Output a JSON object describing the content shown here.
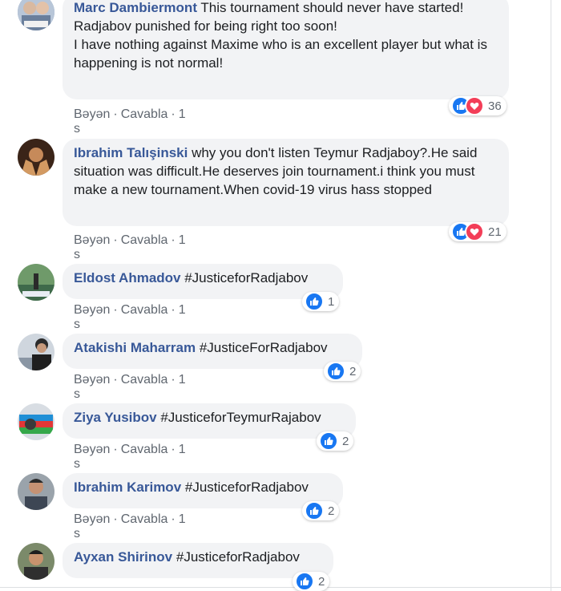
{
  "comments": [
    {
      "author": "Marc Dambiermont",
      "text": " This tournament should never have started!",
      "extra": [
        "Radjabov punished for being right too soon!",
        "I have nothing against Maxime who is an excellent player but what is happening is not normal!"
      ],
      "actions": {
        "like": "Bəyən",
        "reply": "Cavabla",
        "time": "1 s"
      },
      "reactions": {
        "types": [
          "like-icon",
          "love-icon"
        ],
        "count": "36"
      }
    },
    {
      "author": "Ibrahim Talışinski",
      "text": " why you don't listen Teymur Radjaboy?.He said situation was difficult.He deserves join tournament.i think you must make a new tournament.When covid-19 virus hass stopped",
      "actions": {
        "like": "Bəyən",
        "reply": "Cavabla",
        "time": "1 s"
      },
      "reactions": {
        "types": [
          "like-icon",
          "love-icon"
        ],
        "count": "21"
      }
    },
    {
      "author": "Eldost Ahmadov",
      "text": " #JusticeforRadjabov",
      "actions": {
        "like": "Bəyən",
        "reply": "Cavabla",
        "time": "1 s"
      },
      "reactions": {
        "types": [
          "like-icon"
        ],
        "count": "1"
      }
    },
    {
      "author": "Atakishi Maharram",
      "text": " #JusticeForRadjabov",
      "actions": {
        "like": "Bəyən",
        "reply": "Cavabla",
        "time": "1 s"
      },
      "reactions": {
        "types": [
          "like-icon"
        ],
        "count": "2"
      }
    },
    {
      "author": "Ziya Yusibov",
      "text": " #JusticeforTeymurRajabov",
      "actions": {
        "like": "Bəyən",
        "reply": "Cavabla",
        "time": "1 s"
      },
      "reactions": {
        "types": [
          "like-icon"
        ],
        "count": "2"
      }
    },
    {
      "author": "Ibrahim Karimov",
      "text": " #JusticeforRadjabov",
      "actions": {
        "like": "Bəyən",
        "reply": "Cavabla",
        "time": "1 s"
      },
      "reactions": {
        "types": [
          "like-icon"
        ],
        "count": "2"
      }
    },
    {
      "author": "Ayxan Shirinov",
      "text": " #JusticeforRadjabov",
      "reactions": {
        "types": [
          "like-icon"
        ],
        "count": "2"
      }
    }
  ],
  "colors": {
    "author": "#385898",
    "bubble": "#f2f3f5",
    "like": "#1877f2",
    "love": "#f33e58",
    "meta": "#606770"
  }
}
